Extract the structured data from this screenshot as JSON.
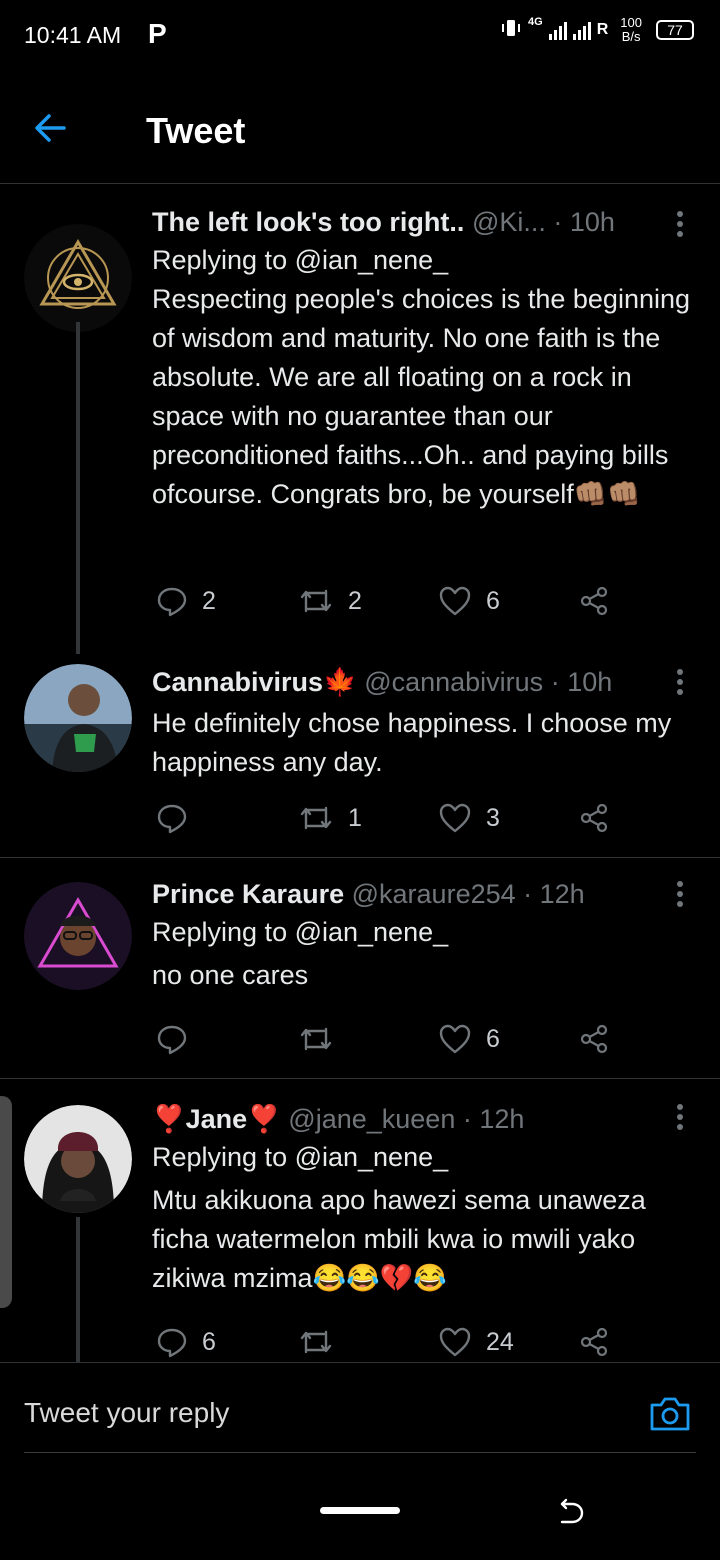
{
  "status_bar": {
    "time": "10:41 AM",
    "app_icon": "P",
    "network": "4G",
    "roaming": "R",
    "speed_value": "100",
    "speed_unit": "B/s",
    "battery": "77"
  },
  "header": {
    "title": "Tweet",
    "back_icon": "arrow-left-icon"
  },
  "tweets": [
    {
      "name": "The left look's too right..",
      "handle": "@Ki...",
      "time": "· 10h",
      "reply_to": "Replying to @ian_nene_",
      "text": "Respecting people's choices is the beginning of wisdom and maturity. No one faith is the absolute. We are all floating on a rock in space with no guarantee than our preconditioned faiths...Oh.. and paying bills ofcourse. Congrats bro, be yourself👊🏽👊🏽",
      "replies": "2",
      "retweets": "2",
      "likes": "6"
    },
    {
      "name": "Cannabivirus🍁",
      "handle": "@cannabivirus",
      "time": "· 10h",
      "text": "He definitely chose happiness. I choose my happiness any day.",
      "replies": "",
      "retweets": "1",
      "likes": "3"
    },
    {
      "name": "Prince Karaure",
      "handle": "@karaure254",
      "time": "· 12h",
      "reply_to": "Replying to @ian_nene_",
      "text": "no one cares",
      "replies": "",
      "retweets": "",
      "likes": "6"
    },
    {
      "name": "❣️Jane❣️",
      "handle": "@jane_kueen",
      "time": "· 12h",
      "reply_to": "Replying to @ian_nene_",
      "text": "Mtu akikuona apo hawezi sema unaweza ficha watermelon mbili kwa io mwili yako zikiwa mzima😂😂💔😂",
      "replies": "6",
      "retweets": "",
      "likes": "24"
    }
  ],
  "reply_bar": {
    "placeholder": "Tweet your reply"
  },
  "colors": {
    "background": "#000000",
    "accent": "#1d9bf0",
    "muted": "#71767b",
    "text": "#e7e9ea"
  }
}
